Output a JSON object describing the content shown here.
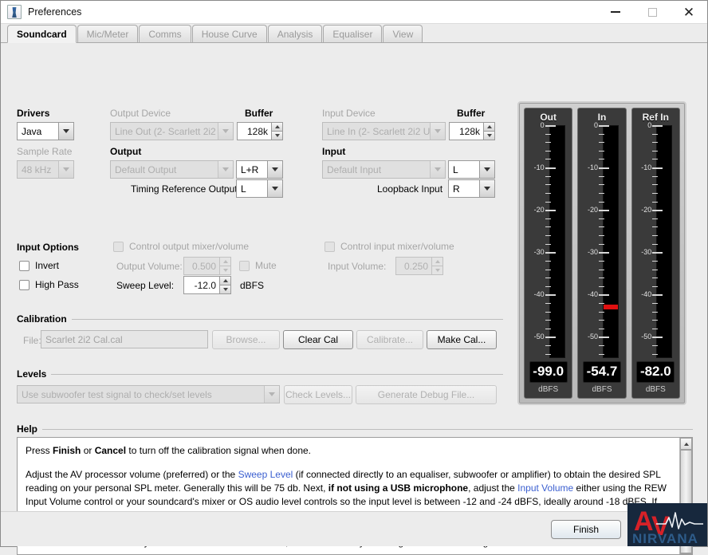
{
  "window": {
    "title": "Preferences",
    "icon": "java-coffee-icon",
    "buttons": {
      "minimize": "minimize",
      "maximize": "maximize",
      "close": "close"
    }
  },
  "tabs": [
    {
      "label": "Soundcard",
      "active": true
    },
    {
      "label": "Mic/Meter",
      "active": false
    },
    {
      "label": "Comms",
      "active": false
    },
    {
      "label": "House Curve",
      "active": false
    },
    {
      "label": "Analysis",
      "active": false
    },
    {
      "label": "Equaliser",
      "active": false
    },
    {
      "label": "View",
      "active": false
    }
  ],
  "soundcard": {
    "drivers_label": "Drivers",
    "drivers_value": "Java",
    "sample_rate_label": "Sample Rate",
    "sample_rate_value": "48 kHz",
    "output_device_label": "Output Device",
    "output_device_value": "Line Out (2- Scarlett 2i2 ...",
    "output_buffer_label": "Buffer",
    "output_buffer_value": "128k",
    "output_label": "Output",
    "output_value": "Default Output",
    "output_channel_value": "L+R",
    "timing_reference_label": "Timing Reference Output",
    "timing_reference_value": "L",
    "input_device_label": "Input Device",
    "input_device_value": "Line In (2- Scarlett 2i2 U...",
    "input_buffer_label": "Buffer",
    "input_buffer_value": "128k",
    "input_label": "Input",
    "input_value": "Default Input",
    "input_channel_value": "L",
    "loopback_label": "Loopback Input",
    "loopback_value": "R"
  },
  "input_options": {
    "title": "Input Options",
    "invert_label": "Invert",
    "invert_checked": false,
    "high_pass_label": "High Pass",
    "high_pass_checked": false,
    "control_output_mixer_label": "Control output mixer/volume",
    "control_input_mixer_label": "Control input mixer/volume",
    "output_volume_label": "Output Volume:",
    "output_volume_value": "0.500",
    "mute_label": "Mute",
    "input_volume_label": "Input Volume:",
    "input_volume_value": "0.250",
    "sweep_level_label": "Sweep Level:",
    "sweep_level_value": "-12.0",
    "sweep_level_units": "dBFS"
  },
  "calibration": {
    "title": "Calibration",
    "file_label": "File:",
    "file_value": "Scarlet 2i2 Cal.cal",
    "browse_label": "Browse...",
    "clear_cal_label": "Clear Cal",
    "calibrate_label": "Calibrate...",
    "make_cal_label": "Make Cal..."
  },
  "levels": {
    "title": "Levels",
    "select_value": "Use subwoofer test signal to check/set levels",
    "check_levels_label": "Check Levels...",
    "generate_debug_label": "Generate Debug File..."
  },
  "meters": {
    "scale_labels": [
      "0",
      "-10",
      "-20",
      "-30",
      "-40",
      "-50"
    ],
    "units": "dBFS",
    "items": [
      {
        "name": "Out",
        "value": "-99.0",
        "peak_db": null
      },
      {
        "name": "In",
        "value": "-54.7",
        "peak_db": -43
      },
      {
        "name": "Ref In",
        "value": "-82.0",
        "peak_db": null
      }
    ]
  },
  "help": {
    "title": "Help",
    "line1_pre": "Press ",
    "line1_b1": "Finish",
    "line1_mid": " or ",
    "line1_b2": "Cancel",
    "line1_post": " to turn off the calibration signal when done.",
    "p2_a": "Adjust the AV processor volume (preferred) or the ",
    "p2_link1": "Sweep Level",
    "p2_b": " (if connected directly to an equaliser, subwoofer or amplifier) to obtain the desired SPL reading on your personal SPL meter. Generally this will be 75 db. Next, ",
    "p2_bold1": "if not using a USB microphone",
    "p2_c": ", adjust the ",
    "p2_link2": "Input Volume",
    "p2_d": " either using the REW Input Volume control or your soundcard's mixer or OS audio level controls so the input level is between -12 and -24 dBFS, ideally around -18 dBFS. If you are using a USB microphone leave the volume control at the unity gain setting, which is selected by default when the mic is first plugged in, input levels with USB microphones are much lower, around -30 to -50 dBFS. If you are using a mic preamp, the level control on it may need adjusting. Note that the level meter is heavily filtered to make it easier to read, it will react slowly to changes in volume setting so allow time for it to settle."
  },
  "footer": {
    "finish_label": "Finish",
    "logo_top": "AV",
    "logo_bottom": "NIRVANA"
  },
  "colors": {
    "accent_link": "#3b5fd0",
    "meter_red": "#e01010",
    "logo_red": "#d62128",
    "logo_bg": "#17283d",
    "window_bg": "#ececec"
  }
}
